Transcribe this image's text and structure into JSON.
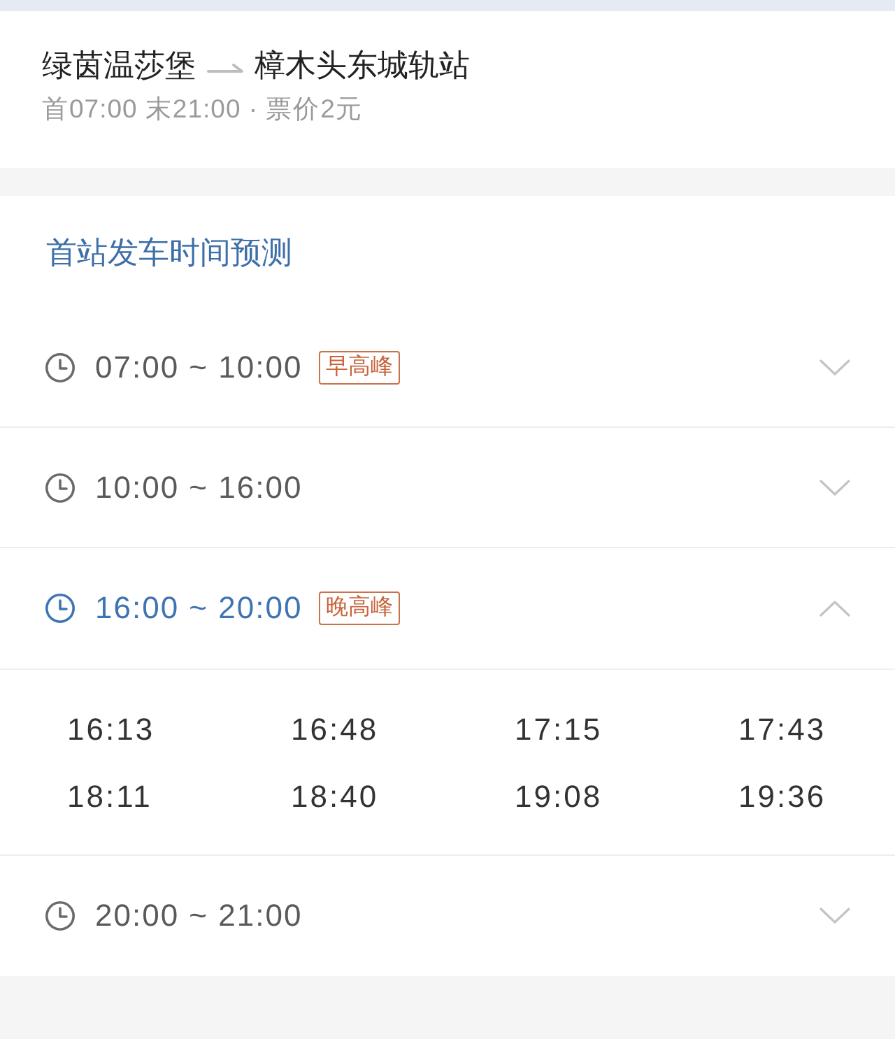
{
  "route": {
    "origin": "绿茵温莎堡",
    "destination": "樟木头东城轨站",
    "info": "首07:00 末21:00 · 票价2元"
  },
  "forecast": {
    "title": "首站发车时间预测",
    "periods": [
      {
        "range": "07:00 ~ 10:00",
        "tag": "早高峰",
        "expanded": false
      },
      {
        "range": "10:00 ~ 16:00",
        "expanded": false
      },
      {
        "range": "16:00 ~ 20:00",
        "tag": "晚高峰",
        "expanded": true,
        "departures": [
          "16:13",
          "16:48",
          "17:15",
          "17:43",
          "18:11",
          "18:40",
          "19:08",
          "19:36"
        ]
      },
      {
        "range": "20:00 ~ 21:00",
        "expanded": false
      }
    ]
  }
}
